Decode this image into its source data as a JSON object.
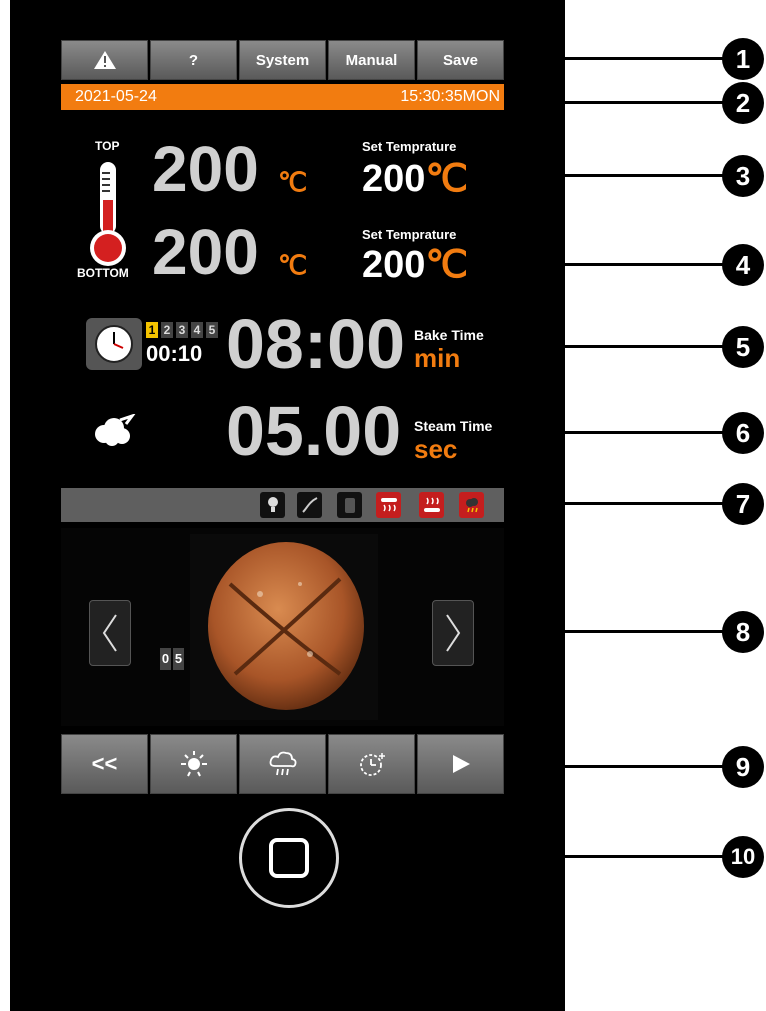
{
  "top_buttons": {
    "warning_label": "",
    "help_label": "?",
    "system_label": "System",
    "manual_label": "Manual",
    "save_label": "Save"
  },
  "status": {
    "date": "2021-05-24",
    "time": "15:30:35MON"
  },
  "temperature": {
    "top_label": "TOP",
    "bottom_label": "BOTTOM",
    "top_value": "200",
    "bottom_value": "200",
    "unit": "℃",
    "set_label": "Set Temprature",
    "set_top_value": "200",
    "set_bottom_value": "200"
  },
  "bake": {
    "steps": [
      "1",
      "2",
      "3",
      "4",
      "5"
    ],
    "active_step": "1",
    "step_time": "00:10",
    "time": "08:00",
    "label": "Bake Time",
    "unit": "min"
  },
  "steam": {
    "time": "05.00",
    "label": "Steam Time",
    "unit": "sec"
  },
  "recipe": {
    "number_digits": [
      "0",
      "5"
    ]
  },
  "bottom_buttons": {
    "back_label": "<<"
  },
  "callouts": [
    "1",
    "2",
    "3",
    "4",
    "5",
    "6",
    "7",
    "8",
    "9",
    "10"
  ],
  "colors": {
    "accent": "#f27c10",
    "step_active": "#f5c400",
    "heater_red": "#c41e1e"
  }
}
